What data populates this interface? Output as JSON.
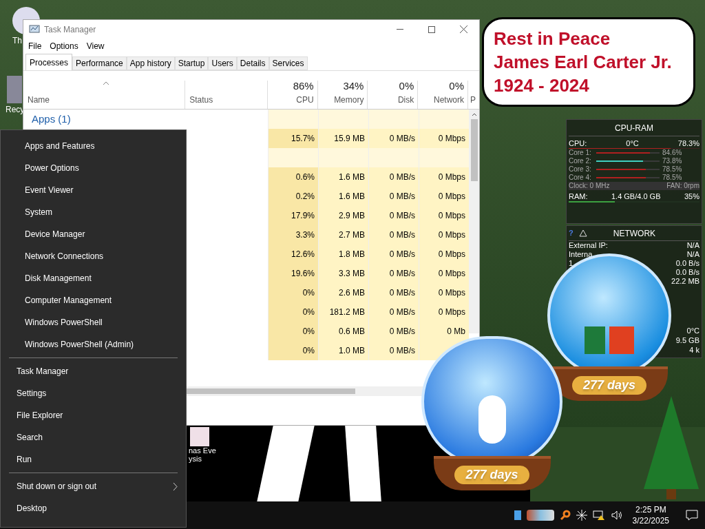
{
  "desktop_icons": [
    {
      "lines": [
        "Th"
      ]
    },
    {
      "lines": [
        "Recy"
      ]
    },
    {
      "lines": [
        "nas Eve",
        "ysis"
      ]
    }
  ],
  "memorial": {
    "lines": [
      "Rest in Peace",
      "James Earl Carter Jr.",
      "1924 - 2024"
    ]
  },
  "task_manager": {
    "title": "Task Manager",
    "menu": [
      "File",
      "Options",
      "View"
    ],
    "tabs": [
      {
        "label": "Processes",
        "selected": true
      },
      {
        "label": "Performance",
        "selected": false
      },
      {
        "label": "App history",
        "selected": false
      },
      {
        "label": "Startup",
        "selected": false
      },
      {
        "label": "Users",
        "selected": false
      },
      {
        "label": "Details",
        "selected": false
      },
      {
        "label": "Services",
        "selected": false
      }
    ],
    "columns": [
      {
        "heading": "Name"
      },
      {
        "heading": "Status"
      },
      {
        "total": "86%",
        "heading": "CPU"
      },
      {
        "total": "34%",
        "heading": "Memory"
      },
      {
        "total": "0%",
        "heading": "Disk"
      },
      {
        "total": "0%",
        "heading": "Network"
      },
      {
        "heading": "P"
      }
    ],
    "rows": [
      {
        "kind": "group",
        "label": "Apps (1)"
      },
      {
        "kind": "process",
        "cpu": "15.7%",
        "memory": "15.9 MB",
        "disk": "0 MB/s",
        "network": "0 Mbps"
      },
      {
        "kind": "group"
      },
      {
        "kind": "process",
        "cpu": "0.6%",
        "memory": "1.6 MB",
        "disk": "0 MB/s",
        "network": "0 Mbps"
      },
      {
        "kind": "process",
        "cpu": "0.2%",
        "memory": "1.6 MB",
        "disk": "0 MB/s",
        "network": "0 Mbps"
      },
      {
        "kind": "process",
        "cpu": "17.9%",
        "memory": "2.9 MB",
        "disk": "0 MB/s",
        "network": "0 Mbps"
      },
      {
        "kind": "process",
        "cpu": "3.3%",
        "memory": "2.7 MB",
        "disk": "0 MB/s",
        "network": "0 Mbps"
      },
      {
        "kind": "process",
        "cpu": "12.6%",
        "memory": "1.8 MB",
        "disk": "0 MB/s",
        "network": "0 Mbps"
      },
      {
        "kind": "process",
        "cpu": "19.6%",
        "memory": "3.3 MB",
        "disk": "0 MB/s",
        "network": "0 Mbps"
      },
      {
        "kind": "process",
        "cpu": "0%",
        "memory": "2.6 MB",
        "disk": "0 MB/s",
        "network": "0 Mbps"
      },
      {
        "kind": "process",
        "cpu": "0%",
        "memory": "181.2 MB",
        "disk": "0 MB/s",
        "network": "0 Mbps"
      },
      {
        "kind": "process",
        "cpu": "0%",
        "memory": "0.6 MB",
        "disk": "0 MB/s",
        "network": "0 Mb"
      },
      {
        "kind": "process",
        "cpu": "0%",
        "memory": "1.0 MB",
        "disk": "0 MB/s"
      }
    ]
  },
  "power_menu": {
    "sections": [
      [
        {
          "label": "Apps and Features",
          "submenu": false
        },
        {
          "label": "Power Options",
          "submenu": false
        },
        {
          "label": "Event Viewer",
          "submenu": false
        },
        {
          "label": "System",
          "submenu": false
        },
        {
          "label": "Device Manager",
          "submenu": false
        },
        {
          "label": "Network Connections",
          "submenu": false
        },
        {
          "label": "Disk Management",
          "submenu": false
        },
        {
          "label": "Computer Management",
          "submenu": false
        },
        {
          "label": "Windows PowerShell",
          "submenu": false
        },
        {
          "label": "Windows PowerShell (Admin)",
          "submenu": false
        }
      ],
      [
        {
          "label": "Task Manager",
          "submenu": false
        },
        {
          "label": "Settings",
          "submenu": false
        },
        {
          "label": "File Explorer",
          "submenu": false
        },
        {
          "label": "Search",
          "submenu": false
        },
        {
          "label": "Run",
          "submenu": false
        }
      ],
      [
        {
          "label": "Shut down or sign out",
          "submenu": true
        },
        {
          "label": "Desktop",
          "submenu": false
        }
      ]
    ]
  },
  "cpu_ram": {
    "title": "CPU-RAM",
    "cpu": {
      "label": "CPU:",
      "temp": "0°C",
      "value": "78.3%",
      "level": 0.78
    },
    "cores": [
      {
        "label": "Core 1:",
        "value": "84.6%",
        "level": 0.85,
        "color": "#b02020"
      },
      {
        "label": "Core 2:",
        "value": "73.8%",
        "level": 0.74,
        "color": "#40d0c0"
      },
      {
        "label": "Core 3:",
        "value": "78.5%",
        "level": 0.78,
        "color": "#b02020"
      },
      {
        "label": "Core 4:",
        "value": "78.5%",
        "level": 0.78,
        "color": "#b02020"
      }
    ],
    "clock": "Clock: 0 MHz",
    "fan": "FAN: 0rpm",
    "ram": {
      "label": "RAM:",
      "amount": "1.4 GB/4.0 GB",
      "value": "35%",
      "level": 0.35
    }
  },
  "network": {
    "help": "?",
    "title": "NETWORK",
    "rows": [
      {
        "label": "External IP:",
        "value": "N/A"
      },
      {
        "label": "Interna",
        "value": "N/A"
      },
      {
        "label": "1",
        "value": "0.0 B/s"
      },
      {
        "value": "0.0 B/s"
      },
      {
        "value": "22.2 MB"
      }
    ]
  },
  "gadget_3": {
    "rows": [
      "0°C",
      "9.5 GB",
      "4 k"
    ]
  },
  "globes": [
    {
      "label": "277 days"
    },
    {
      "label": "277 days"
    }
  ],
  "taskbar": {
    "time": "2:25 PM",
    "date": "3/22/2025"
  }
}
